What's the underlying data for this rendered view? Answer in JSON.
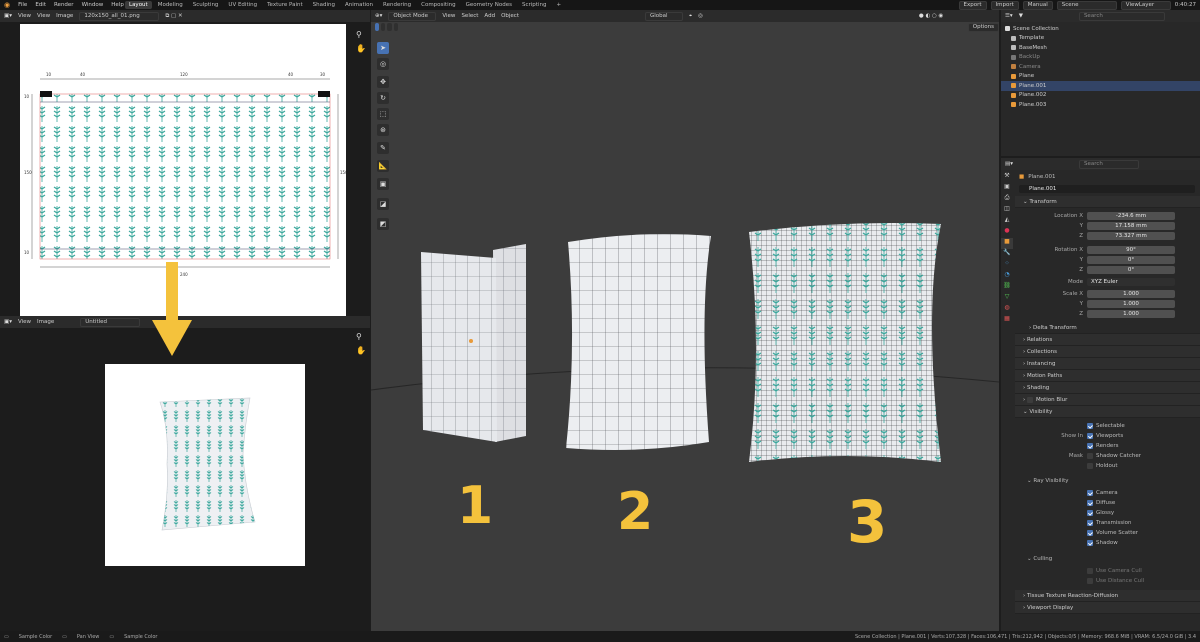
{
  "topbar": {
    "menus": [
      "File",
      "Edit",
      "Render",
      "Window",
      "Help"
    ],
    "workspaces": [
      "Layout",
      "Modeling",
      "Sculpting",
      "UV Editing",
      "Texture Paint",
      "Shading",
      "Animation",
      "Rendering",
      "Compositing",
      "Geometry Nodes",
      "Scripting",
      "+"
    ],
    "active_workspace": "Layout",
    "import_label": "Import",
    "export_label": "Export",
    "manual_label": "Manual",
    "scene_label": "Scene",
    "viewlayer_label": "ViewLayer",
    "time": "0:40:27"
  },
  "image_editor_top": {
    "menus": [
      "View",
      "View",
      "Image"
    ],
    "image_name": "120x150_all_01.png",
    "dims": {
      "top": [
        "10",
        "40",
        "120",
        "40",
        "30"
      ],
      "side_left": "150",
      "side_right": "150",
      "bottom": "240",
      "corner_top": "10",
      "corner_bottom": "10"
    }
  },
  "image_editor_bottom": {
    "menus": [
      "View",
      "Image"
    ],
    "image_name": "Untitled"
  },
  "viewport": {
    "mode": "Object Mode",
    "menus": [
      "View",
      "Select",
      "Add",
      "Object"
    ],
    "orientation": "Global",
    "options_label": "Options",
    "labels": [
      "1",
      "2",
      "3"
    ]
  },
  "outliner": {
    "search_placeholder": "Search",
    "items": [
      {
        "label": "Scene Collection",
        "color": "#cfcfcf"
      },
      {
        "label": "Template",
        "color": "#cfcfcf"
      },
      {
        "label": "BaseMesh",
        "color": "#cfcfcf"
      },
      {
        "label": "BackUp",
        "color": "#9a9a9a"
      },
      {
        "label": "Camera",
        "color": "#9a9a9a"
      },
      {
        "label": "Plane",
        "color": "#cfcfcf"
      },
      {
        "label": "Plane.001",
        "color": "#cfcfcf"
      },
      {
        "label": "Plane.002",
        "color": "#cfcfcf"
      },
      {
        "label": "Plane.003",
        "color": "#cfcfcf"
      }
    ]
  },
  "properties": {
    "search_placeholder": "Search",
    "object_name": "Plane.001",
    "object_field": "Plane.001",
    "transform_label": "Transform",
    "rows": [
      {
        "label": "Location X",
        "value": "-234.6 mm"
      },
      {
        "label": "Y",
        "value": "17.158 mm"
      },
      {
        "label": "Z",
        "value": "73.327 mm"
      },
      {
        "label": "Rotation X",
        "value": "90°"
      },
      {
        "label": "Y",
        "value": "0°"
      },
      {
        "label": "Z",
        "value": "0°"
      },
      {
        "label": "Mode",
        "value": "XYZ Euler"
      },
      {
        "label": "Scale X",
        "value": "1.000"
      },
      {
        "label": "Y",
        "value": "1.000"
      },
      {
        "label": "Z",
        "value": "1.000"
      }
    ],
    "sections": [
      "Delta Transform",
      "Relations",
      "Collections",
      "Instancing",
      "Motion Paths",
      "Shading",
      "Motion Blur",
      "Visibility"
    ],
    "visibility": {
      "selectable": "Selectable",
      "show_in_label": "Show In",
      "viewports": "Viewports",
      "renders": "Renders",
      "mask_label": "Mask",
      "shadow_catcher": "Shadow Catcher",
      "holdout": "Holdout"
    },
    "ray_visibility": {
      "title": "Ray Visibility",
      "items": [
        "Camera",
        "Diffuse",
        "Glossy",
        "Transmission",
        "Volume Scatter",
        "Shadow"
      ]
    },
    "culling": {
      "title": "Culling",
      "items": [
        "Use Camera Cull",
        "Use Distance Cull"
      ]
    },
    "bottom_sections": [
      "Tissue Texture Reaction-Diffusion",
      "Viewport Display"
    ]
  },
  "statusbar": {
    "left": [
      "Sample Color",
      "Pan View",
      "Sample Color"
    ],
    "right": "Scene Collection | Plane.001 | Verts:107,328 | Faces:106,471 | Tris:212,942 | Objects:0/5 | Memory: 968.6 MiB | VRAM: 6.5/24.0 GiB | 3.4"
  }
}
